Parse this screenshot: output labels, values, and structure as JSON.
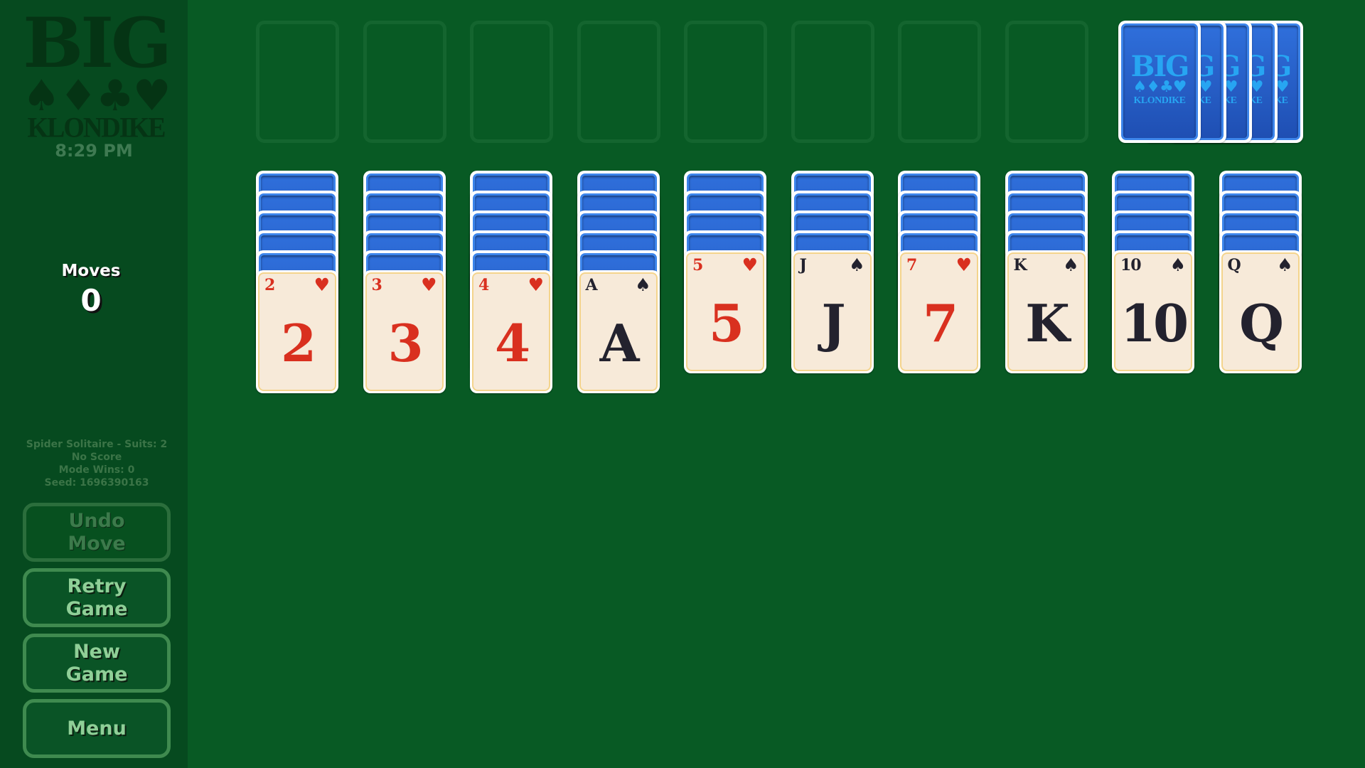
{
  "game": {
    "title_line1": "BIG",
    "title_suits": "♠♦♣♥",
    "title_line2": "KLONDIKE",
    "clock": "8:29 PM"
  },
  "moves": {
    "label": "Moves",
    "value": "0"
  },
  "info": {
    "mode": "Spider Solitaire - Suits: 2",
    "score": "No Score",
    "mode_wins": "Mode Wins: 0",
    "seed": "Seed: 1696390163"
  },
  "buttons": [
    {
      "id": "undo-move",
      "label": "Undo\nMove",
      "enabled": false
    },
    {
      "id": "retry-game",
      "label": "Retry\nGame",
      "enabled": true
    },
    {
      "id": "new-game",
      "label": "New\nGame",
      "enabled": true
    },
    {
      "id": "menu",
      "label": "Menu",
      "enabled": true
    }
  ],
  "card_back": {
    "line1": "BIG",
    "suits": "♠♦♣♥",
    "line2": "KLONDIKE"
  },
  "foundations": {
    "count": 8,
    "filled": 0
  },
  "stock": {
    "deals_remaining": 5
  },
  "tableau": [
    {
      "face_down": 5,
      "top": {
        "rank": "2",
        "suit": "hearts",
        "symbol": "♥",
        "color": "red"
      }
    },
    {
      "face_down": 5,
      "top": {
        "rank": "3",
        "suit": "hearts",
        "symbol": "♥",
        "color": "red"
      }
    },
    {
      "face_down": 5,
      "top": {
        "rank": "4",
        "suit": "hearts",
        "symbol": "♥",
        "color": "red"
      }
    },
    {
      "face_down": 5,
      "top": {
        "rank": "A",
        "suit": "spades",
        "symbol": "♠",
        "color": "black"
      }
    },
    {
      "face_down": 4,
      "top": {
        "rank": "5",
        "suit": "hearts",
        "symbol": "♥",
        "color": "red"
      }
    },
    {
      "face_down": 4,
      "top": {
        "rank": "J",
        "suit": "spades",
        "symbol": "♠",
        "color": "black"
      }
    },
    {
      "face_down": 4,
      "top": {
        "rank": "7",
        "suit": "hearts",
        "symbol": "♥",
        "color": "red"
      }
    },
    {
      "face_down": 4,
      "top": {
        "rank": "K",
        "suit": "spades",
        "symbol": "♠",
        "color": "black"
      }
    },
    {
      "face_down": 4,
      "top": {
        "rank": "10",
        "suit": "spades",
        "symbol": "♠",
        "color": "black"
      }
    },
    {
      "face_down": 4,
      "top": {
        "rank": "Q",
        "suit": "spades",
        "symbol": "♠",
        "color": "black"
      }
    }
  ],
  "colors": {
    "sidebar_bg": "#064a1f",
    "table_bg": "#085a24",
    "card_back_blue": "#2f6fdb",
    "card_face": "#f7ead9",
    "red_suit": "#d9301f",
    "black_suit": "#23222e",
    "button_border": "#3f8a4f"
  }
}
